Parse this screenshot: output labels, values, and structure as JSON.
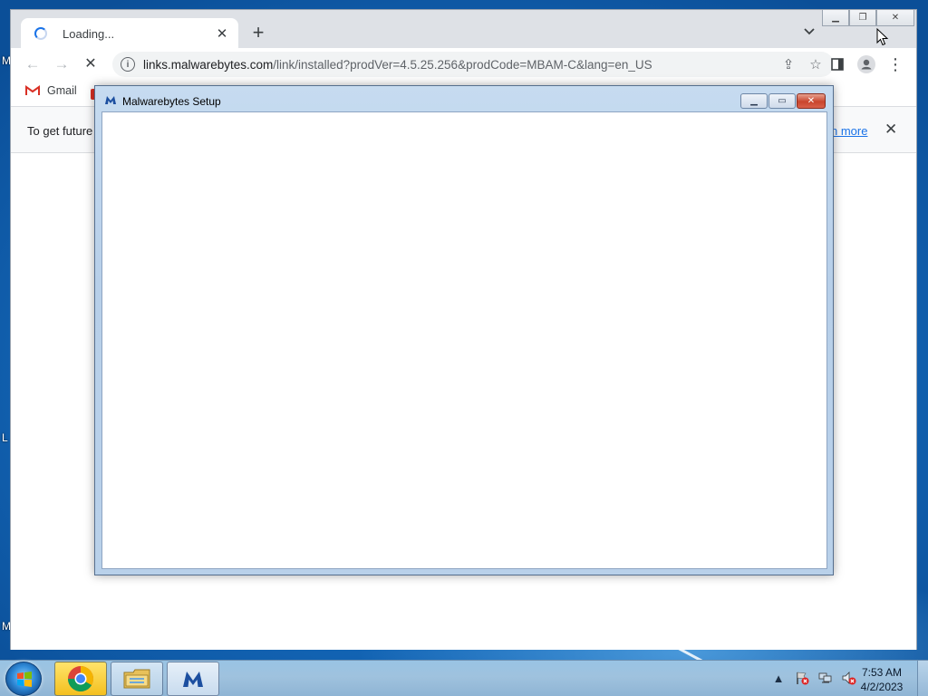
{
  "chrome": {
    "tab_title": "Loading...",
    "url_host": "links.malwarebytes.com",
    "url_path": "/link/installed?prodVer=4.5.25.256&prodCode=MBAM-C&lang=en_US",
    "bookmarks": [
      {
        "label": "Gmail",
        "icon": "gmail-icon"
      }
    ],
    "infobar_text": "To get future",
    "infobar_link": "n more"
  },
  "setup_dialog": {
    "title": "Malwarebytes Setup"
  },
  "taskbar": {
    "apps": [
      {
        "name": "chrome",
        "icon": "chrome-icon"
      },
      {
        "name": "explorer",
        "icon": "folder-icon"
      },
      {
        "name": "malwarebytes",
        "icon": "malwarebytes-icon"
      }
    ],
    "time": "7:53 AM",
    "date": "4/2/2023"
  },
  "desktop": {
    "icon_letters": [
      "M",
      "L",
      "M"
    ]
  },
  "colors": {
    "accent": "#1a73e8",
    "desktop": "#1467b8",
    "close_red": "#c9452d"
  }
}
